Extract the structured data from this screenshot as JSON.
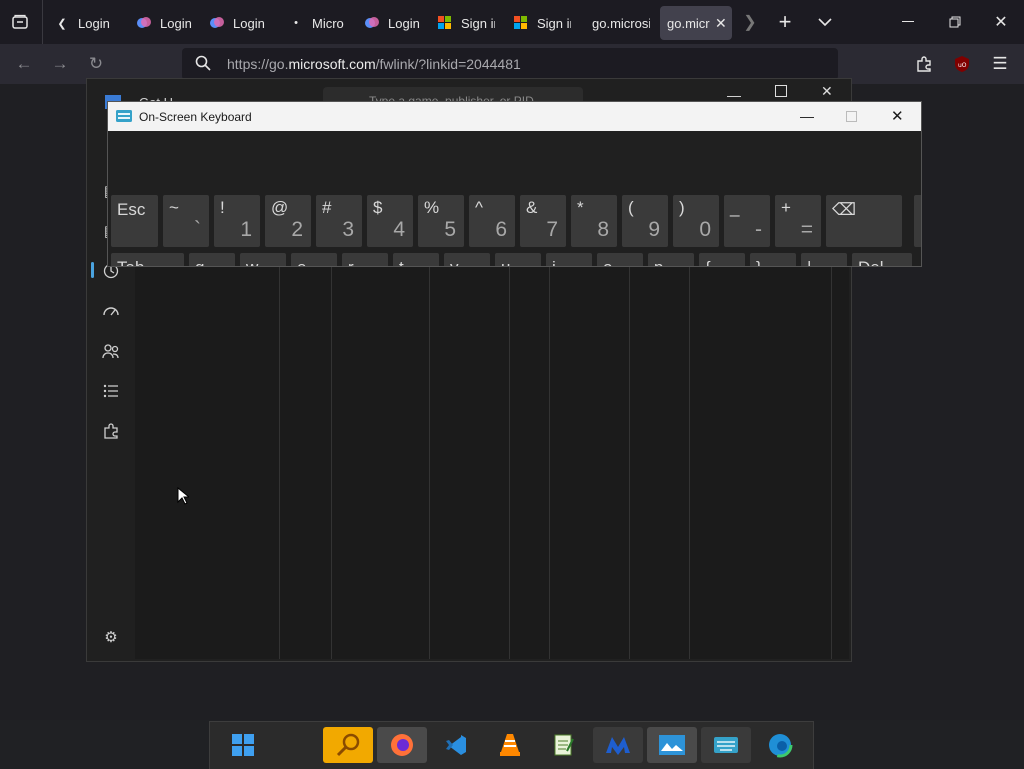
{
  "browser": {
    "tabs": [
      {
        "label": "Login",
        "icon": "chevron-left-icon"
      },
      {
        "label": "Login",
        "icon": "copilot-icon"
      },
      {
        "label": "Login",
        "icon": "copilot-icon"
      },
      {
        "label": "Micros",
        "icon": "dot-icon"
      },
      {
        "label": "Login",
        "icon": "copilot-icon"
      },
      {
        "label": "Sign in",
        "icon": "microsoft-logo-icon"
      },
      {
        "label": "Sign in",
        "icon": "microsoft-logo-icon"
      },
      {
        "label": "go.microsi",
        "icon": "none"
      },
      {
        "label": "go.micr",
        "icon": "none"
      }
    ],
    "url_prefix": "https://go.",
    "url_domain": "microsoft.com",
    "url_rest": "/fwlink/?linkid=2044481",
    "colors": {
      "accent": "#42414d",
      "urlbar": "#1c1b22"
    }
  },
  "store_window": {
    "title_partial": "Get H",
    "search_placeholder": "Type a game, publisher, or PID",
    "sidebar_icons": [
      "menu-icon",
      "library-icon",
      "library-icon",
      "history-icon",
      "speedometer-icon",
      "users-icon",
      "list-icon",
      "puzzle-icon",
      "settings-icon"
    ]
  },
  "osk": {
    "title": "On-Screen Keyboard",
    "row1": [
      {
        "single": "Esc"
      },
      {
        "up": "~",
        "dn": "`"
      },
      {
        "up": "!",
        "dn": "1"
      },
      {
        "up": "@",
        "dn": "2"
      },
      {
        "up": "#",
        "dn": "3"
      },
      {
        "up": "$",
        "dn": "4"
      },
      {
        "up": "%",
        "dn": "5"
      },
      {
        "up": "^",
        "dn": "6"
      },
      {
        "up": "&",
        "dn": "7"
      },
      {
        "up": "*",
        "dn": "8"
      },
      {
        "up": "(",
        "dn": "9"
      },
      {
        "up": ")",
        "dn": "0"
      },
      {
        "up": "_",
        "dn": "-"
      },
      {
        "up": "+",
        "dn": "="
      },
      {
        "single": "⌫"
      }
    ],
    "row2": [
      {
        "single": "Tab"
      },
      {
        "single": "q"
      },
      {
        "single": "w"
      },
      {
        "single": "e"
      },
      {
        "single": "r"
      },
      {
        "single": "t"
      },
      {
        "single": "y"
      },
      {
        "single": "u"
      },
      {
        "single": "i"
      },
      {
        "single": "o"
      },
      {
        "single": "p"
      },
      {
        "single": "{"
      },
      {
        "single": "}"
      },
      {
        "single": "|"
      },
      {
        "single": "Del"
      }
    ]
  },
  "taskbar": {
    "apps": [
      "windows-start-icon",
      "search-tool-icon",
      "firefox-icon",
      "vscode-icon",
      "vlc-icon",
      "notepad-icon",
      "malwarebytes-icon",
      "photo-app-icon",
      "on-screen-keyboard-icon",
      "edge-icon"
    ]
  }
}
